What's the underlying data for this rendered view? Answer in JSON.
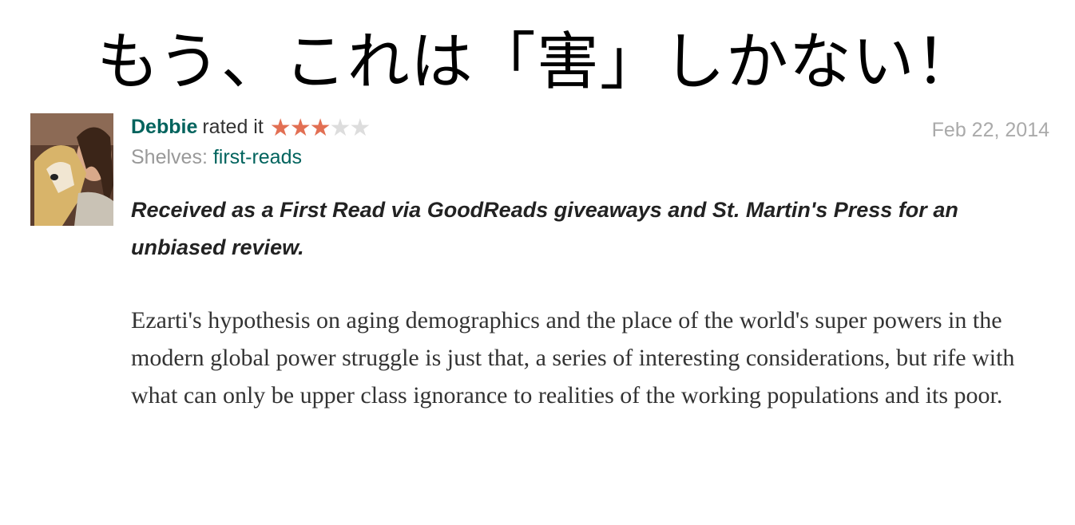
{
  "headline": {
    "before": "もう、これは「",
    "kanji": "害",
    "after": "」しかない！"
  },
  "review": {
    "user_name": "Debbie",
    "rated_text": "rated it",
    "rating": {
      "value": 3,
      "max": 5,
      "on_color": "#e26f53",
      "off_color": "#dddddd"
    },
    "stars": [
      "★",
      "★",
      "★",
      "★",
      "★"
    ],
    "shelves_label": "Shelves:",
    "shelf": "first-reads",
    "date": "Feb 22, 2014",
    "intro": "Received as a First Read via GoodReads giveaways and St. Martin's Press for an unbiased review.",
    "body": "Ezarti's hypothesis on aging demographics and the place of the world's super powers in the modern global power struggle is just that, a series of interesting considerations, but rife with what can only be upper class ignorance to realities of the working populations and its poor."
  },
  "colors": {
    "link": "#00635d",
    "muted": "#999999",
    "date": "#aaaaaa",
    "star": "#e26f53"
  },
  "icons": {
    "avatar": "user-photo-avatar",
    "star": "star-icon"
  }
}
